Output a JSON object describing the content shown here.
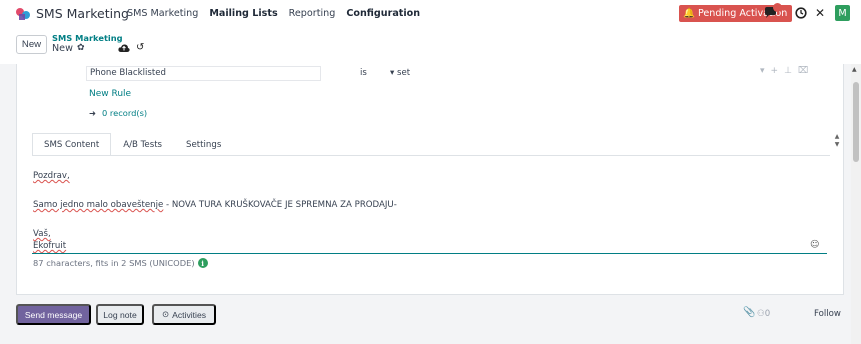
{
  "navbar": {
    "app_name": "SMS Marketing",
    "menu": [
      "SMS Marketing",
      "Mailing Lists",
      "Reporting",
      "Configuration"
    ],
    "active_menu": "Mailing Lists",
    "pending_label": "Pending Activation",
    "avatar_letter": "M",
    "colors": {
      "pending": "#d9534f",
      "avatar": "#2e9e5e"
    }
  },
  "control_panel": {
    "new_label": "New",
    "breadcrumb_parent": "SMS Marketing",
    "breadcrumb_current": "New"
  },
  "rule": {
    "field": "Phone Blacklisted",
    "operator": "is",
    "value": "set",
    "new_rule_label": "New Rule",
    "records_label": "0 record(s)"
  },
  "tabs": [
    "SMS Content",
    "A/B Tests",
    "Settings"
  ],
  "content": {
    "greeting": "Pozdrav,",
    "line_prefix": "Samo jedno malo obaveštenje",
    "line_rest": " - NOVA TURA KRUŠKOVAČE JE SPREMNA ZA PRODAJU-",
    "closing": "Vaš,",
    "signature": "Ekofruit",
    "counter": "87 characters, fits in 2 SMS (UNICODE)"
  },
  "chatter": {
    "send_label": "Send message",
    "log_label": "Log note",
    "activities_label": "Activities",
    "followers_count": "0",
    "follow_label": "Follow",
    "send_color": "#71639e"
  }
}
